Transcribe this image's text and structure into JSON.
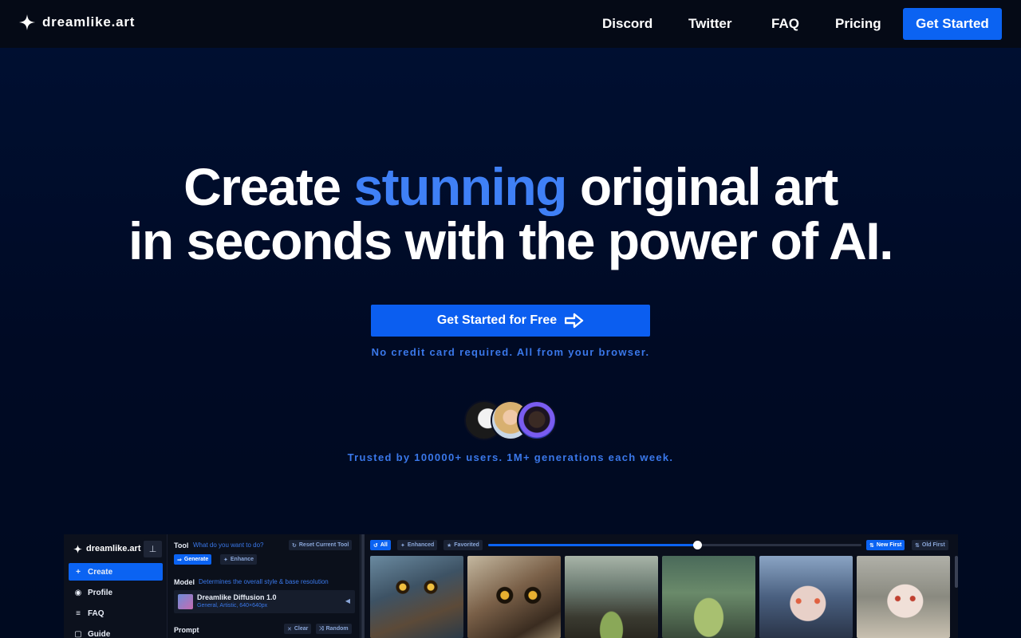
{
  "nav": {
    "brand": "dreamlike.art",
    "links": [
      "Discord",
      "Twitter",
      "FAQ",
      "Pricing"
    ],
    "cta": "Get Started"
  },
  "hero": {
    "headline_pre": "Create ",
    "headline_accent": "stunning",
    "headline_post": " original art",
    "headline_line2": "in seconds with the power of AI.",
    "cta": "Get Started for Free",
    "note": "No credit card required. All from your browser.",
    "trusted": "Trusted by 100000+ users. 1M+ generations each week."
  },
  "colors": {
    "accent": "#3f80f6",
    "button": "#0b63f2",
    "background": "#000f30"
  },
  "icons": [
    "sparkle-logo-icon",
    "arrow-right-icon",
    "pin-icon",
    "plus-icon",
    "profile-icon",
    "list-icon",
    "book-icon"
  ],
  "preview": {
    "brand": "dreamlike.art",
    "sidebar": [
      {
        "label": "Create",
        "icon": "+"
      },
      {
        "label": "Profile",
        "icon": "◉"
      },
      {
        "label": "FAQ",
        "icon": "≡"
      },
      {
        "label": "Guide",
        "icon": "▢"
      }
    ],
    "tool": {
      "label": "Tool",
      "hint": "What do you want to do?",
      "reset": "Reset Current Tool",
      "generate": "Generate",
      "enhance": "Enhance"
    },
    "model": {
      "label": "Model",
      "hint": "Determines the overall style & base resolution",
      "name": "Dreamlike Diffusion 1.0",
      "desc": "General, Artistic, 640×640px"
    },
    "prompt": {
      "label": "Prompt",
      "clear": "Clear",
      "random": "Random"
    },
    "gallery": {
      "filters": [
        "All",
        "Enhanced",
        "Favorited"
      ],
      "sort": [
        "New First",
        "Old First"
      ],
      "slider_fraction": 0.56
    }
  }
}
